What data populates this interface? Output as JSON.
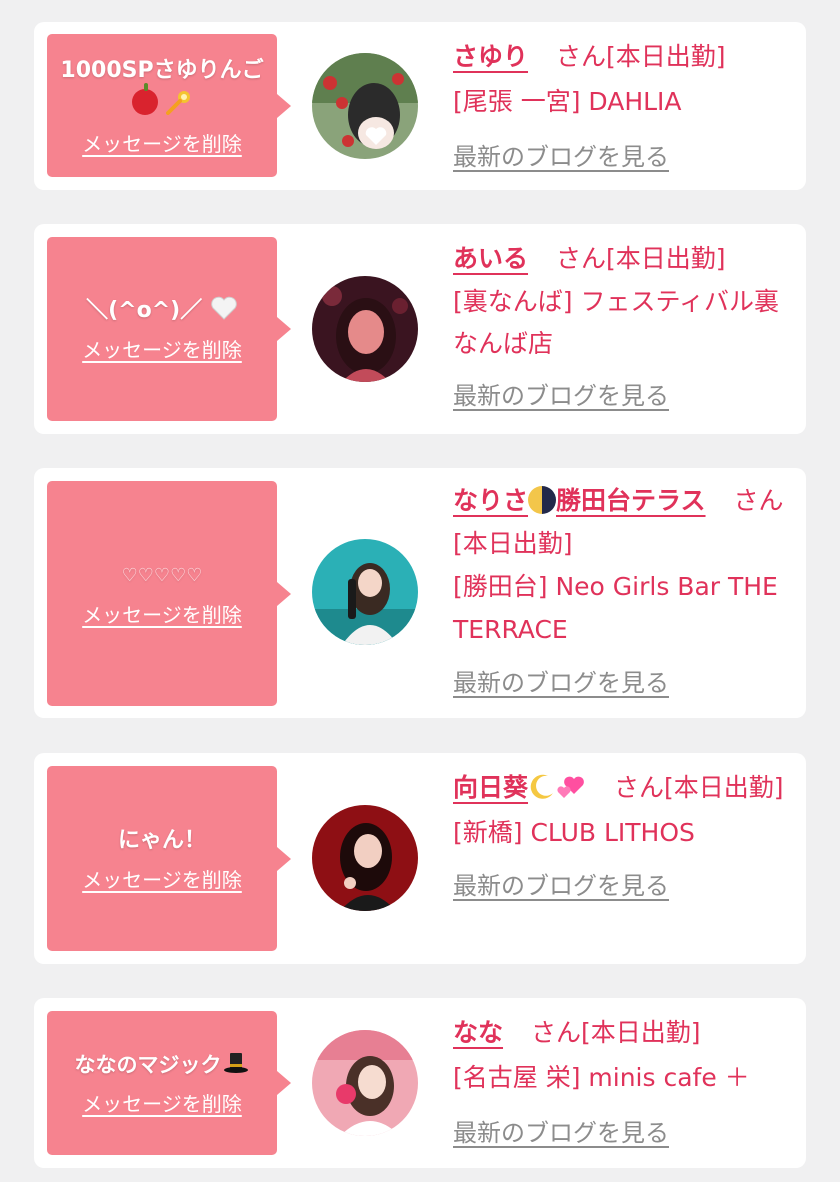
{
  "messages": [
    {
      "bubble_text": "1000SPさゆりんご",
      "bubble_icons": [
        "apple-icon",
        "sparkle-icon"
      ],
      "delete_label": "メッセージを削除",
      "name": "さゆり",
      "san": "さん",
      "status": "[本日出勤]",
      "shop": "[尾張 一宮] DAHLIA",
      "blog_label": "最新のブログを見る"
    },
    {
      "bubble_text": "＼(^o^)／",
      "bubble_icons": [
        "white-heart-icon"
      ],
      "delete_label": "メッセージを削除",
      "name": "あいる",
      "san": "さん",
      "status": "[本日出勤]",
      "shop": "[裏なんば] フェスティバル裏なんば店",
      "blog_label": "最新のブログを見る"
    },
    {
      "bubble_text": "♡♡♡♡♡",
      "bubble_icons": [],
      "delete_label": "メッセージを削除",
      "name_prefix": "なりさ",
      "name_suffix": "勝田台テラス",
      "name_icons": [
        "half-moon-icon"
      ],
      "san": "さん",
      "status": "[本日出勤]",
      "shop": "[勝田台] Neo Girls Bar THE TERRACE",
      "blog_label": "最新のブログを見る"
    },
    {
      "bubble_text": "にゃん！",
      "bubble_icons": [],
      "delete_label": "メッセージを削除",
      "name": "向日葵",
      "name_icons": [
        "crescent-moon-icon",
        "two-hearts-icon"
      ],
      "san": "さん",
      "status": "[本日出勤]",
      "shop": "[新橋] CLUB LITHOS",
      "blog_label": "最新のブログを見る"
    },
    {
      "bubble_text": "ななのマジック",
      "bubble_icons": [
        "top-hat-icon"
      ],
      "delete_label": "メッセージを削除",
      "name": "なな",
      "san": "さん",
      "status": "[本日出勤]",
      "shop": "[名古屋 栄] minis cafe ＋",
      "blog_label": "最新のブログを見る"
    }
  ],
  "colors": {
    "background": "#f0f0f1",
    "card": "#ffffff",
    "bubble": "#f6838f",
    "accent": "#e0325a",
    "link_gray": "#8c8c8c"
  }
}
